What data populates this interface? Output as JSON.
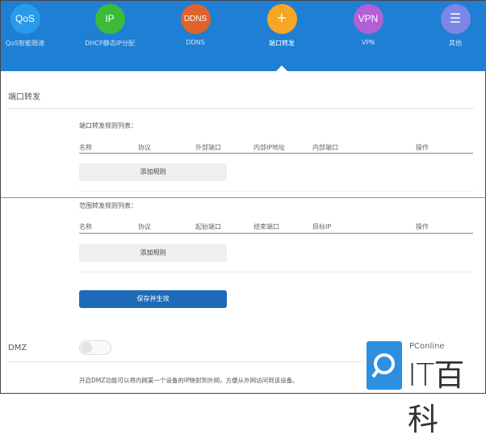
{
  "nav": [
    {
      "icon": "QoS",
      "label": "QoS智能限速",
      "color": "#2a9be8"
    },
    {
      "icon": "IP",
      "label": "DHCP静态IP分配",
      "color": "#3cba3c"
    },
    {
      "icon": "DDNS",
      "label": "DDNS",
      "color": "#e0622c"
    },
    {
      "icon": "+",
      "label": "端口转发",
      "color": "#f5a623"
    },
    {
      "icon": "VPN",
      "label": "VPN",
      "color": "#b35fd6"
    },
    {
      "icon": "☰",
      "label": "其他",
      "color": "#7b86e6"
    }
  ],
  "page_title": "端口转发",
  "port_rules": {
    "title": "端口转发规则列表：",
    "columns": [
      "名称",
      "协议",
      "外部端口",
      "内部IP地址",
      "内部端口",
      "操作"
    ],
    "add_label": "添加规则"
  },
  "range_rules": {
    "title": "范围转发规则列表：",
    "columns": [
      "名称",
      "协议",
      "起始端口",
      "结束端口",
      "目标IP",
      "操作"
    ],
    "add_label": "添加规则"
  },
  "save_label": "保存并生效",
  "dmz": {
    "label": "DMZ",
    "enabled": false,
    "description": "开启DMZ功能可以将内网某一个设备的IP映射到外网，方便从外网访问到该设备。"
  },
  "watermark": {
    "brand": "PConline",
    "name": "IT百科"
  }
}
